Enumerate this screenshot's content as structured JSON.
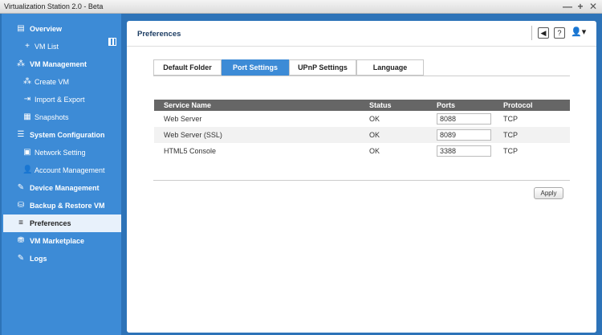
{
  "window": {
    "title": "Virtualization Station 2.0 - Beta",
    "min": "—",
    "max": "+",
    "close": "✕"
  },
  "sidebar": {
    "items": [
      {
        "label": "Overview",
        "icon": "overview-icon",
        "glyph": "▤"
      },
      {
        "label": "VM List",
        "icon": "plus-icon",
        "glyph": "+"
      },
      {
        "label": "VM Management",
        "icon": "vm-management-icon",
        "glyph": "⁂"
      },
      {
        "label": "Create VM",
        "icon": "create-vm-icon",
        "glyph": "⁂"
      },
      {
        "label": "Import & Export",
        "icon": "import-export-icon",
        "glyph": "⇥"
      },
      {
        "label": "Snapshots",
        "icon": "snapshots-icon",
        "glyph": "▦"
      },
      {
        "label": "System Configuration",
        "icon": "system-config-icon",
        "glyph": "☰"
      },
      {
        "label": "Network Setting",
        "icon": "network-icon",
        "glyph": "▣"
      },
      {
        "label": "Account Management",
        "icon": "account-icon",
        "glyph": "👤"
      },
      {
        "label": "Device Management",
        "icon": "device-icon",
        "glyph": "✎"
      },
      {
        "label": "Backup & Restore VM",
        "icon": "backup-icon",
        "glyph": "⛁"
      },
      {
        "label": "Preferences",
        "icon": "preferences-icon",
        "glyph": "≡"
      },
      {
        "label": "VM Marketplace",
        "icon": "marketplace-icon",
        "glyph": "⛃"
      },
      {
        "label": "Logs",
        "icon": "logs-icon",
        "glyph": "✎"
      }
    ]
  },
  "panel": {
    "title": "Preferences",
    "header_buttons": {
      "speaker": "◀",
      "help": "?",
      "user": "👤▾"
    }
  },
  "tabs": [
    "Default Folder",
    "Port Settings",
    "UPnP Settings",
    "Language"
  ],
  "active_tab": "Port Settings",
  "table": {
    "headers": [
      "Service Name",
      "Status",
      "Ports",
      "Protocol"
    ],
    "rows": [
      {
        "service": "Web Server",
        "status": "OK",
        "port": "8088",
        "protocol": "TCP"
      },
      {
        "service": "Web Server (SSL)",
        "status": "OK",
        "port": "8089",
        "protocol": "TCP"
      },
      {
        "service": "HTML5 Console",
        "status": "OK",
        "port": "3388",
        "protocol": "TCP"
      }
    ]
  },
  "apply_label": "Apply",
  "colors": {
    "accent": "#3d8bd6",
    "sidebar_bg": "#3d8bd6",
    "header_dark": "#666666"
  }
}
